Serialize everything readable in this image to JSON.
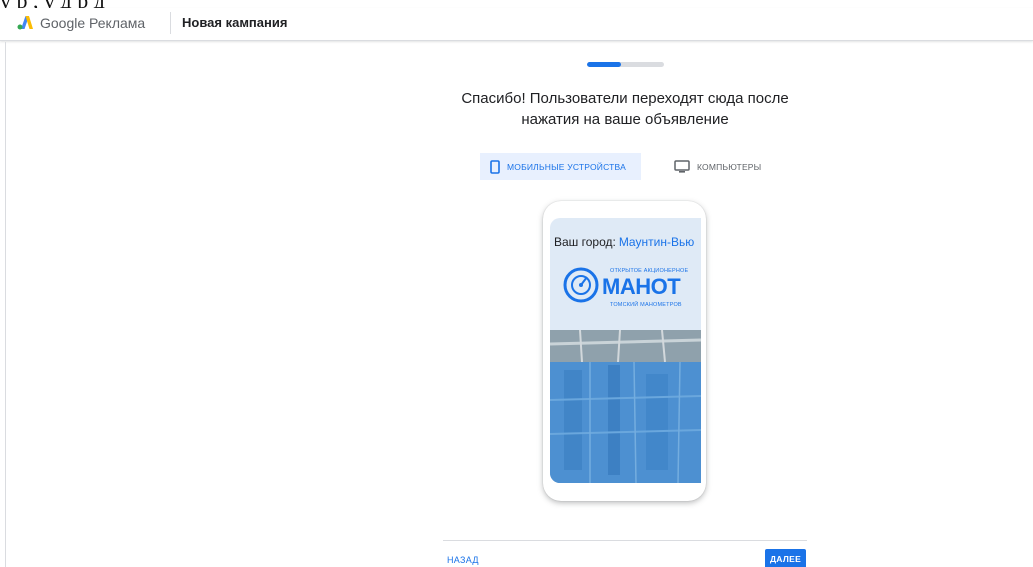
{
  "doc_strip": {
    "text": "у                                    р                                   ,  у д                р    д"
  },
  "header": {
    "brand_google": "Google",
    "brand_product": "Реклама",
    "campaign_title": "Новая кампания"
  },
  "progress": {
    "fraction": 0.44
  },
  "headline": "Спасибо! Пользователи переходят сюда после нажатия на ваше объявление",
  "tabs": [
    {
      "label": "МОБИЛЬНЫЕ УСТРОЙСТВА",
      "icon": "smartphone-icon",
      "selected": true
    },
    {
      "label": "КОМПЬЮТЕРЫ",
      "icon": "desktop-icon",
      "selected": false
    }
  ],
  "preview": {
    "city_label": "Ваш город:",
    "city_value": "Мaунтин-Вью",
    "company_top": "ОТКРЫТОЕ   АКЦИОНЕРНОЕ",
    "company_name": "МАНОТ",
    "company_bottom": "ТОМСКИЙ   МАНОМЕТРОВ"
  },
  "footer": {
    "back_label": "НАЗАД",
    "next_label": "ДАЛЕЕ"
  },
  "colors": {
    "accent": "#1a73e8",
    "tab_selected_bg": "#e8f0fe",
    "divider": "#dadce0"
  }
}
